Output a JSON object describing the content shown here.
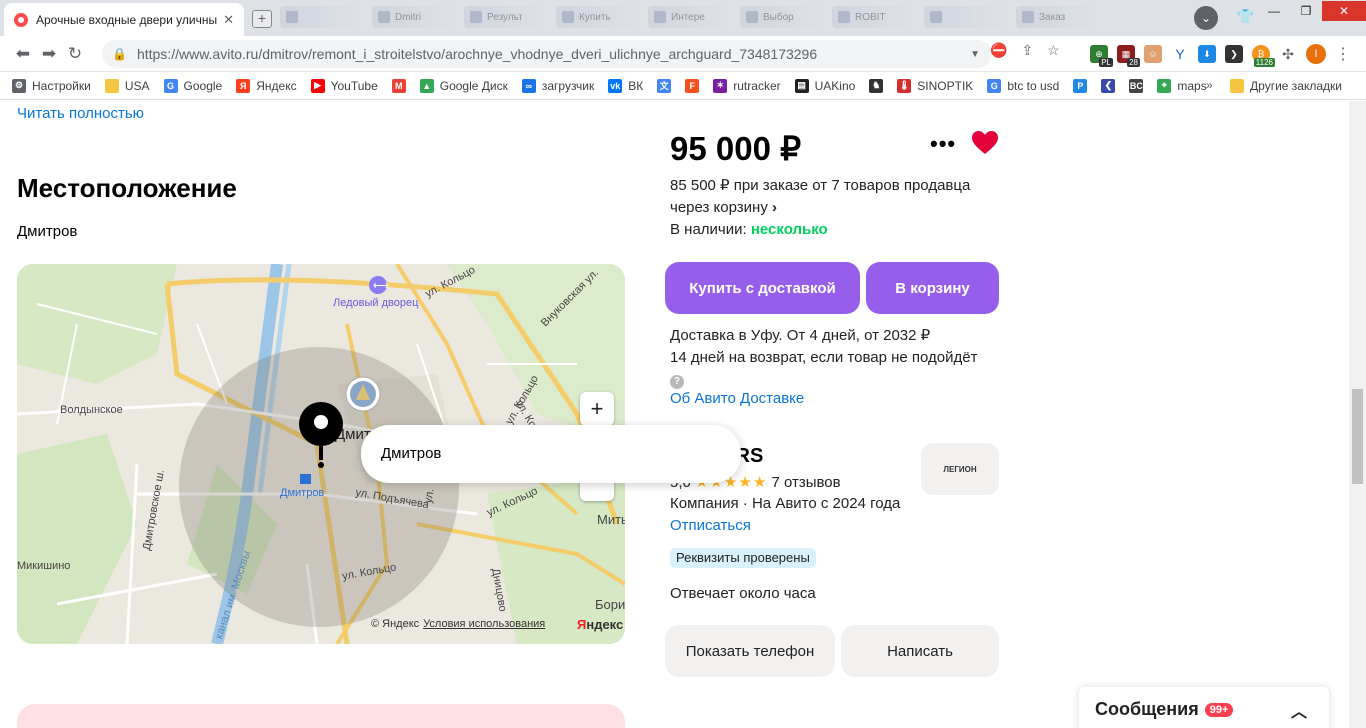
{
  "browser": {
    "active_tab_title": "Арочные входные двери уличные",
    "background_tabs": [
      "",
      "Dmitri",
      "Результ",
      "Купить",
      "Интере",
      "Выбор",
      "ROBIT",
      "",
      "Заказ"
    ],
    "url": "https://www.avito.ru/dmitrov/remont_i_stroitelstvo/arochnye_vhodnye_dveri_ulichnye_archguard_7348173296",
    "extension_badges": {
      "pl": "PL",
      "count": "28",
      "stat": "1126"
    },
    "profile_letter": "I"
  },
  "bookmarks": [
    {
      "label": "Настройки",
      "icon": "gear-icon",
      "color": "#5f6368"
    },
    {
      "label": "USA",
      "icon": "folder-icon",
      "color": "#f5c542"
    },
    {
      "label": "Google",
      "icon": "google-icon",
      "color": "#4285f4"
    },
    {
      "label": "Яндекс",
      "icon": "yandex-icon",
      "color": "#fc3f1d"
    },
    {
      "label": "YouTube",
      "icon": "youtube-icon",
      "color": "#ff0000"
    },
    {
      "label": "",
      "icon": "gmail-icon",
      "color": "#ea4335"
    },
    {
      "label": "Google Диск",
      "icon": "drive-icon",
      "color": "#34a853"
    },
    {
      "label": "загрузчик",
      "icon": "loop-icon",
      "color": "#1a73e8"
    },
    {
      "label": "ВК",
      "icon": "vk-icon",
      "color": "#0077ff"
    },
    {
      "label": "",
      "icon": "translate-icon",
      "color": "#4285f4"
    },
    {
      "label": "",
      "icon": "f-icon",
      "color": "#f4511e"
    },
    {
      "label": "rutracker",
      "icon": "star-icon",
      "color": "#7b1fa2"
    },
    {
      "label": "UAKino",
      "icon": "film-icon",
      "color": "#222222"
    },
    {
      "label": "",
      "icon": "chess-icon",
      "color": "#333333"
    },
    {
      "label": "SINOPTIK",
      "icon": "thermometer-icon",
      "color": "#d32f2f"
    },
    {
      "label": "btc to usd",
      "icon": "google-icon",
      "color": "#4285f4"
    },
    {
      "label": "",
      "icon": "p-icon",
      "color": "#1e88e5"
    },
    {
      "label": "",
      "icon": "arrow-icon",
      "color": "#3949ab"
    },
    {
      "label": "",
      "icon": "bc-icon",
      "color": "#444444"
    },
    {
      "label": "maps",
      "icon": "maps-icon",
      "color": "#34a853"
    }
  ],
  "bookmarks_other": "Другие закладки",
  "page": {
    "read_more": "Читать полностью",
    "location_heading": "Местоположение",
    "city": "Дмитров",
    "map": {
      "labels": {
        "ice_palace": "Ледовый дворец",
        "kolco1": "ул. Кольцо",
        "vnukovskaya": "Внуковская ул.",
        "voldynskoe": "Волдынское",
        "dmitrov_center": "Дмитров",
        "station": "Дмитров",
        "kolco2": "ул. Кольцо",
        "kolco3": "ул. Кольцо",
        "kolco4": "ул. Кольцо",
        "podyacheva": "ул. Подъячева",
        "dmitrovskoe": "Дмитровское ш.",
        "mikishino": "Микишино",
        "canal": "канал им. Москвы",
        "dnicovo": "Дницово",
        "mit": "Мить",
        "bori": "Бори",
        "ul1": "ул.",
        "ul2": "ул. Колы"
      },
      "copyright": "© Яндекс",
      "terms": "Условия использования",
      "brand_1": "Я",
      "brand_2": "ндекс",
      "popup": "Дмитров"
    },
    "price": "95 000 ₽",
    "cart_offer": "85 500 ₽ при заказе от 7 товаров продавца через корзину",
    "availability_label": "В наличии:",
    "availability_value": "несколько",
    "buy_delivery": "Купить с доставкой",
    "to_cart": "В корзину",
    "delivery_line1": "Доставка в Уфу. От 4 дней, от 2032 ₽",
    "delivery_line2": "14 дней на возврат, если товар не подойдёт",
    "avito_delivery": "Об Авито Доставке",
    "seller_name": "N DOORS",
    "rating_value": "5,0",
    "stars": "★★★★★",
    "reviews": "7 отзывов",
    "company_info": "Компания · На Авито с 2024 года",
    "unsubscribe": "Отписаться",
    "verified": "Реквизиты проверены",
    "reply_time": "Отвечает около часа",
    "seller_logo": "ЛЕГИОН",
    "show_phone": "Показать телефон",
    "write": "Написать",
    "messages": "Сообщения",
    "messages_badge": "99+"
  },
  "colors": {
    "accent": "#965eeb",
    "link": "#0a75d8",
    "green": "#02d15c",
    "heart": "#e4003a"
  }
}
